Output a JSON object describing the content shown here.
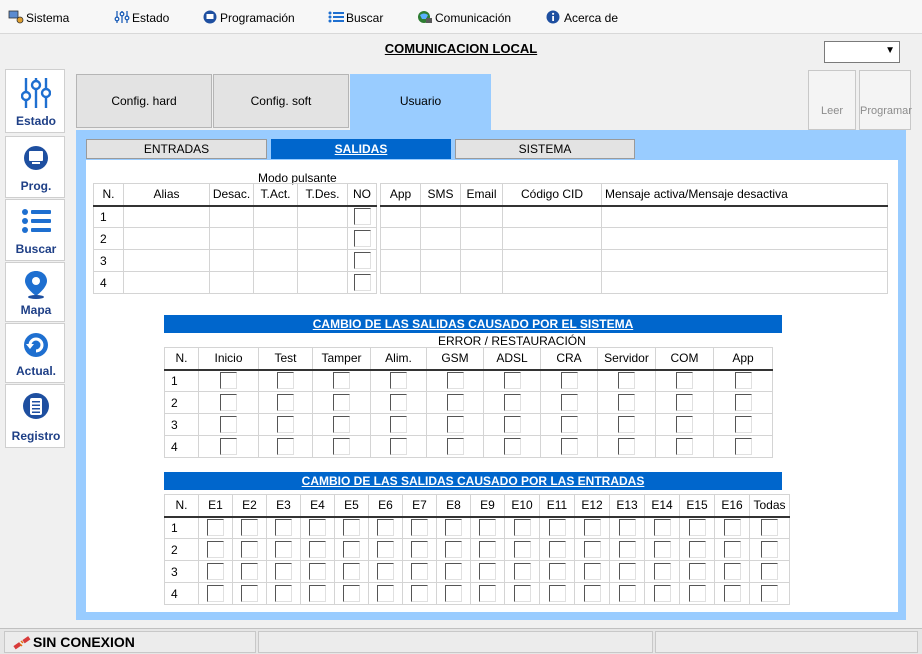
{
  "menu": [
    {
      "label": "Sistema",
      "icon": "system-icon"
    },
    {
      "label": "Estado",
      "icon": "sliders-icon"
    },
    {
      "label": "Programación",
      "icon": "monitor-icon"
    },
    {
      "label": "Buscar",
      "icon": "list-icon"
    },
    {
      "label": "Comunicación",
      "icon": "globe-icon"
    },
    {
      "label": "Acerca de",
      "icon": "info-icon"
    }
  ],
  "header": {
    "title": "COMUNICACION LOCAL",
    "combo_value": ""
  },
  "sidebar": [
    {
      "label": "Estado",
      "icon": "sliders-icon"
    },
    {
      "label": "Prog.",
      "icon": "monitor-icon"
    },
    {
      "label": "Buscar",
      "icon": "list-icon"
    },
    {
      "label": "Mapa",
      "icon": "map-pin-icon"
    },
    {
      "label": "Actual.",
      "icon": "refresh-icon"
    },
    {
      "label": "Registro",
      "icon": "log-icon"
    }
  ],
  "top_tabs": [
    {
      "label": "Config. hard",
      "active": false
    },
    {
      "label": "Config. soft",
      "active": false
    },
    {
      "label": "Usuario",
      "active": true
    }
  ],
  "actions": {
    "leer": "Leer",
    "programar": "Programar"
  },
  "sub_tabs": [
    {
      "label": "ENTRADAS",
      "active": false
    },
    {
      "label": "SALIDAS",
      "active": true
    },
    {
      "label": "SISTEMA",
      "active": false
    }
  ],
  "outputs_table": {
    "caption": "Modo pulsante",
    "headers": [
      "N.",
      "Alias",
      "Desac.",
      "T.Act.",
      "T.Des.",
      "NO"
    ],
    "rows": [
      "1",
      "2",
      "3",
      "4"
    ]
  },
  "notify_table": {
    "headers": [
      "App",
      "SMS",
      "Email",
      "Código CID",
      "Mensaje activa/Mensaje desactiva"
    ]
  },
  "system_section": {
    "banner": "CAMBIO DE LAS SALIDAS CAUSADO POR EL SISTEMA",
    "subtitle": "ERROR / RESTAURACIÓN",
    "headers": [
      "N.",
      "Inicio",
      "Test",
      "Tamper",
      "Alim.",
      "GSM",
      "ADSL",
      "CRA",
      "Servidor",
      "COM",
      "App"
    ],
    "rows": [
      "1",
      "2",
      "3",
      "4"
    ]
  },
  "inputs_section": {
    "banner": "CAMBIO DE LAS SALIDAS CAUSADO POR LAS ENTRADAS",
    "headers": [
      "N.",
      "E1",
      "E2",
      "E3",
      "E4",
      "E5",
      "E6",
      "E7",
      "E8",
      "E9",
      "E10",
      "E11",
      "E12",
      "E13",
      "E14",
      "E15",
      "E16",
      "Todas"
    ],
    "rows": [
      "1",
      "2",
      "3",
      "4"
    ]
  },
  "status": {
    "text": "SIN  CONEXION",
    "icon": "disconnected-icon"
  },
  "colors": {
    "panel_blue": "#99ccff",
    "accent_blue": "#0066cc",
    "sidebar_text": "#1e3f86"
  }
}
